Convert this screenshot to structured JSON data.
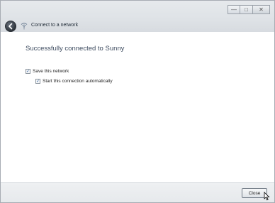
{
  "window": {
    "title": "Connect to a network",
    "caption_buttons": {
      "minimize_glyph": "—",
      "maximize_glyph": "□",
      "close_glyph": "✕"
    },
    "back_icon": "back-arrow-icon",
    "network_icon": "wireless-network-icon"
  },
  "content": {
    "heading": "Successfully connected to Sunny",
    "options": [
      {
        "label": "Save this network",
        "checked": true
      },
      {
        "label": "Start this connection automatically",
        "checked": true
      }
    ]
  },
  "footer": {
    "close_label": "Close"
  },
  "colors": {
    "heading": "#3c4a5e",
    "titlebar": "#dfe3e7",
    "footer": "#eceef0"
  }
}
